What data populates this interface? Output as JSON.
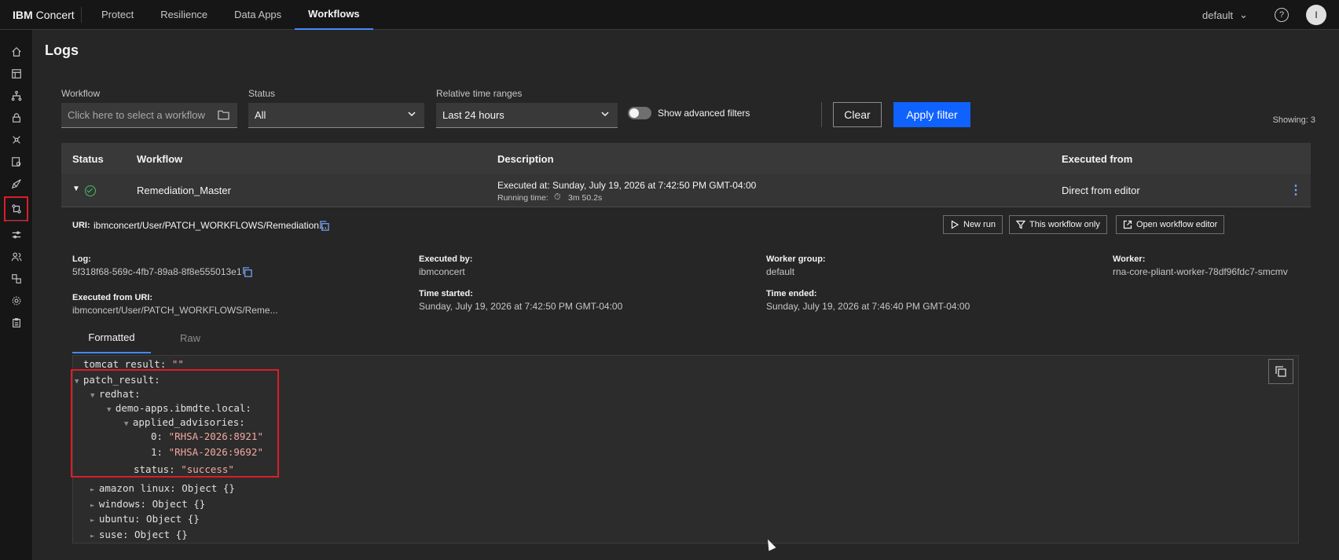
{
  "header": {
    "brand_bold": "IBM",
    "brand_rest": "Concert",
    "nav": [
      "Protect",
      "Resilience",
      "Data Apps",
      "Workflows"
    ],
    "active_nav": "Workflows",
    "tenant": "default",
    "avatar_initial": "I"
  },
  "rail": {
    "icons": [
      "home-icon",
      "dashboard-icon",
      "topology-icon",
      "lock-icon",
      "network-icon",
      "dashboard-settings-icon",
      "rocket-icon",
      "workflow-icon",
      "sliders-icon",
      "users-icon",
      "data-icon",
      "settings-icon",
      "clipboard-icon"
    ],
    "active": "workflow-icon"
  },
  "page": {
    "title": "Logs"
  },
  "filters": {
    "workflow_label": "Workflow",
    "workflow_placeholder": "Click here to select a workflow",
    "status_label": "Status",
    "status_value": "All",
    "time_label": "Relative time ranges",
    "time_value": "Last 24 hours",
    "advanced_label": "Show advanced filters",
    "clear_label": "Clear",
    "apply_label": "Apply filter",
    "showing": "Showing: 3"
  },
  "table": {
    "headers": [
      "Status",
      "Workflow",
      "Description",
      "Executed from"
    ],
    "row": {
      "workflow": "Remediation_Master",
      "executed_at": "Executed at: Sunday, July 19, 2026 at 7:42:50 PM GMT-04:00",
      "running_time_label": "Running time:",
      "running_time": "3m 50.2s",
      "executed_from": "Direct from editor"
    }
  },
  "details": {
    "uri_label": "URI:",
    "uri_value": "ibmconcert/User/PATCH_WORKFLOWS/Remediation...",
    "buttons": {
      "new_run": "New run",
      "this_workflow_only": "This workflow only",
      "open_editor": "Open workflow editor"
    },
    "log_label": "Log:",
    "log_value": "5f318f68-569c-4fb7-89a8-8f8e555013e1",
    "executed_by_label": "Executed by:",
    "executed_by_value": "ibmconcert",
    "worker_group_label": "Worker group:",
    "worker_group_value": "default",
    "worker_label": "Worker:",
    "worker_value": "rna-core-pliant-worker-78df96fdc7-smcmv",
    "executed_from_uri_label": "Executed from URI:",
    "executed_from_uri_value": "ibmconcert/User/PATCH_WORKFLOWS/Reme...",
    "time_started_label": "Time started:",
    "time_started_value": "Sunday, July 19, 2026 at 7:42:50 PM GMT-04:00",
    "time_ended_label": "Time ended:",
    "time_ended_value": "Sunday, July 19, 2026 at 7:46:40 PM GMT-04:00",
    "tabs": [
      "Formatted",
      "Raw"
    ],
    "active_tab": "Formatted"
  },
  "code": {
    "tomcat_key": "tomcat_result: ",
    "tomcat_val": "\"\"",
    "patch_key": "patch_result:",
    "redhat_key": "redhat:",
    "host_key": "demo-apps.ibmdte.local:",
    "advisories_key": "applied_advisories:",
    "adv0_key": "0: ",
    "adv0_val": "\"RHSA-2026:8921\"",
    "adv1_key": "1: ",
    "adv1_val": "\"RHSA-2026:9692\"",
    "status_key": "status: ",
    "status_val": "\"success\"",
    "amazon": "amazon linux: Object {}",
    "windows": "windows: Object {}",
    "ubuntu": "ubuntu: Object {}",
    "suse": "suse: Object {}"
  },
  "colors": {
    "accent": "#0f62fe",
    "success": "#42be65",
    "highlight": "#da1e28"
  }
}
